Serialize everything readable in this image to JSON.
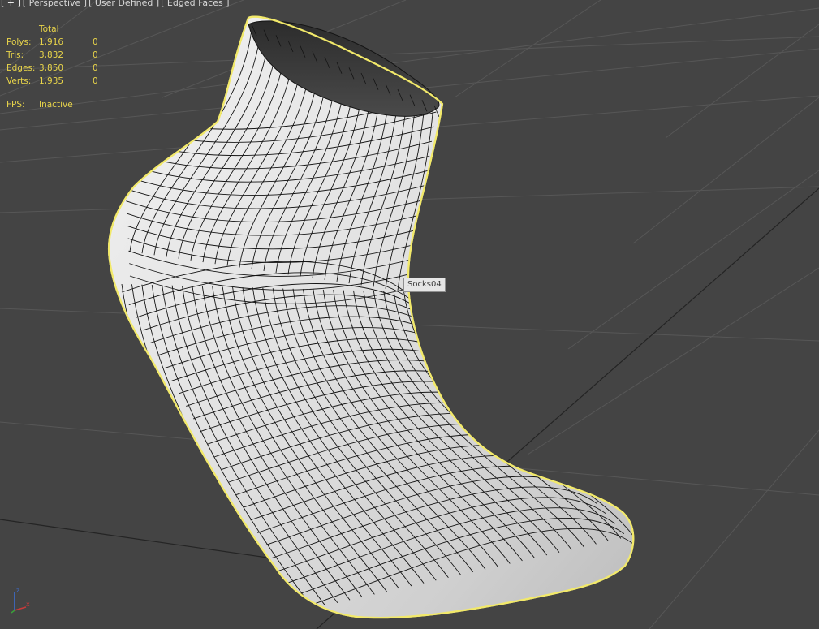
{
  "viewport": {
    "labels": [
      "[ + ]",
      "[ Perspective ]",
      "[ User Defined ]",
      "[ Edged Faces ]"
    ]
  },
  "stats": {
    "header": "Total",
    "rows": [
      {
        "key": "Polys:",
        "total": "1,916",
        "selected": "0"
      },
      {
        "key": "Tris:",
        "total": "3,832",
        "selected": "0"
      },
      {
        "key": "Edges:",
        "total": "3,850",
        "selected": "0"
      },
      {
        "key": "Verts:",
        "total": "1,935",
        "selected": "0"
      }
    ],
    "fps_key": "FPS:",
    "fps_value": "Inactive"
  },
  "object": {
    "name": "Socks04"
  },
  "gizmo": {
    "z": "z",
    "x": "x"
  },
  "colors": {
    "background": "#444444",
    "grid": "#5a5a5a",
    "grid_main": "#222222",
    "selection_outline": "#f2e96a",
    "mesh_fill": "#ebebeb",
    "wire": "#1a1a1a",
    "stats_text": "#e8d44a"
  }
}
